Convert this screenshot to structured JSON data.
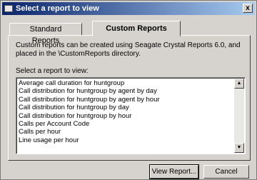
{
  "window": {
    "title": "Select a report to view",
    "close_glyph": "x"
  },
  "tabs": [
    {
      "label": "Standard Reports"
    },
    {
      "label": "Custom Reports"
    }
  ],
  "panel": {
    "description": "Custom reports can be created using Seagate Crystal Reports 6.0, and placed in the \\CustomReports directory.",
    "select_label": "Select a report to view:",
    "reports": [
      "Average call duration for huntgroup",
      "Call distribution for huntgroup by agent by day",
      "Call distribution for huntgroup by agent by hour",
      "Call distribution for huntgroup by day",
      "Call distribution for huntgroup by hour",
      "Calls per Account Code",
      "Calls per hour",
      "Line usage per hour"
    ]
  },
  "buttons": {
    "view": "View Report...",
    "cancel": "Cancel"
  }
}
